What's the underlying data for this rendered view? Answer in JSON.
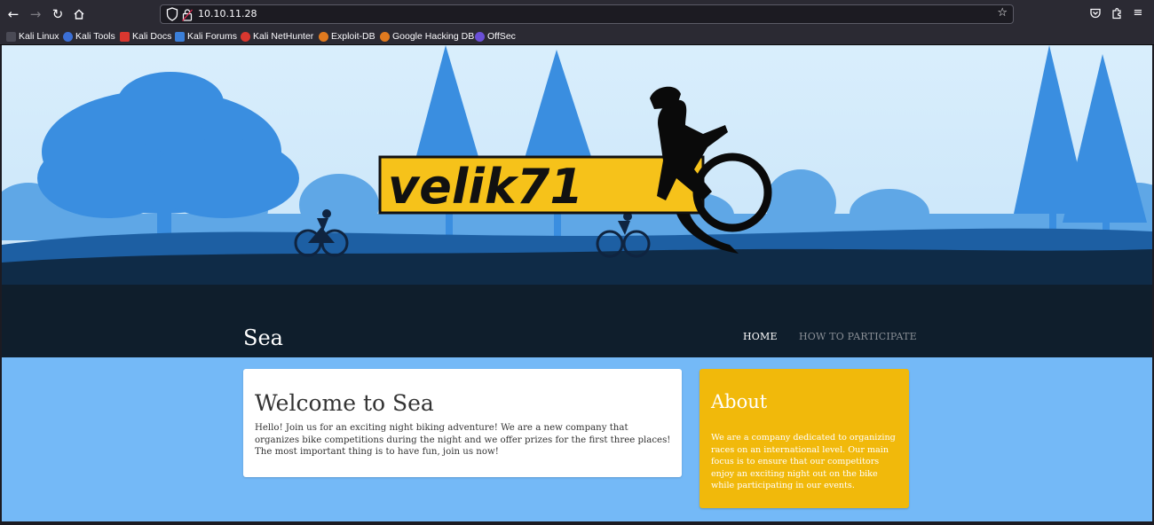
{
  "browser": {
    "url": "10.10.11.28",
    "bookmarks": [
      {
        "label": "Kali Linux",
        "icon": "kali-dragon-icon",
        "color": "#4a4a55"
      },
      {
        "label": "Kali Tools",
        "icon": "kali-tools-icon",
        "color": "#3b6fd6"
      },
      {
        "label": "Kali Docs",
        "icon": "kali-docs-icon",
        "color": "#d9372f"
      },
      {
        "label": "Kali Forums",
        "icon": "kali-forums-icon",
        "color": "#3b7fd9"
      },
      {
        "label": "Kali NetHunter",
        "icon": "nethunter-icon",
        "color": "#d9372f"
      },
      {
        "label": "Exploit-DB",
        "icon": "exploit-db-icon",
        "color": "#e07a1f"
      },
      {
        "label": "Google Hacking DB",
        "icon": "ghdb-icon",
        "color": "#e07a1f"
      },
      {
        "label": "OffSec",
        "icon": "offsec-icon",
        "color": "#6a4fd6"
      }
    ]
  },
  "hero": {
    "logo_text": "velik71"
  },
  "site": {
    "title": "Sea",
    "nav": {
      "home": "HOME",
      "how_to_participate": "HOW TO PARTICIPATE"
    }
  },
  "welcome": {
    "heading": "Welcome to Sea",
    "body": "Hello! Join us for an exciting night biking adventure! We are a new company that organizes bike competitions during the night and we offer prizes for the first three places! The most important thing is to have fun, join us now!"
  },
  "about": {
    "heading": "About",
    "body": "We are a company dedicated to organizing races on an international level. Our main focus is to ensure that our competitors enjoy an exciting night out on the bike while participating in our events."
  },
  "colors": {
    "page_bg": "#74b9f7",
    "about_bg": "#f1b90b",
    "hero_dark": "#0f1e2c",
    "logo_yellow": "#f6c21a"
  }
}
